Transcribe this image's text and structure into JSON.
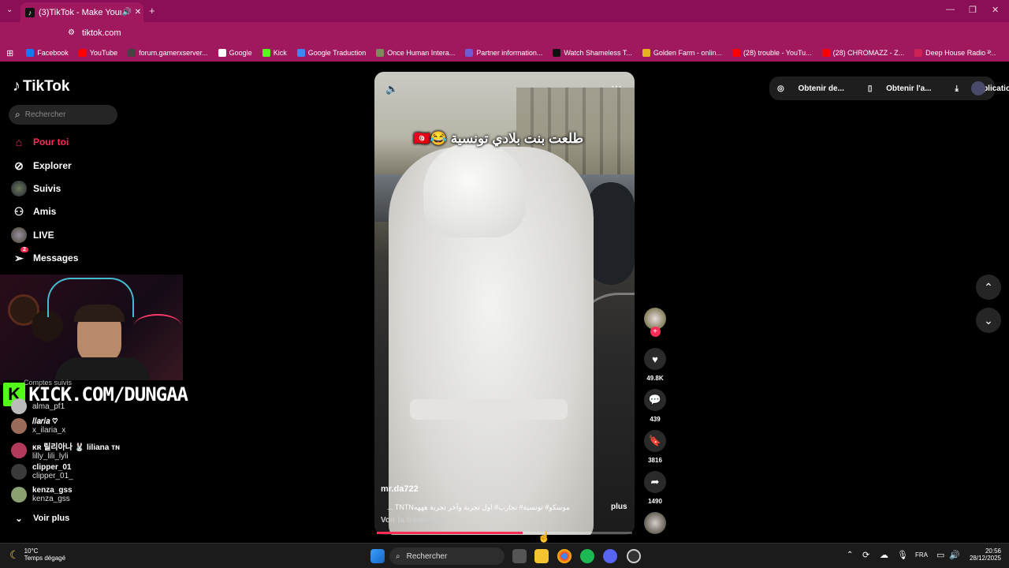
{
  "browser": {
    "tab_title": "(3)TikTok - Make Your Day",
    "url": "tiktok.com",
    "bookmarks": [
      {
        "label": "Facebook",
        "color": "#1877f2"
      },
      {
        "label": "YouTube",
        "color": "#ff0000"
      },
      {
        "label": "forum.gamerxserver...",
        "color": "#444444"
      },
      {
        "label": "Google",
        "color": "#ffffff"
      },
      {
        "label": "Kick",
        "color": "#53fc18"
      },
      {
        "label": "Google Traduction",
        "color": "#4285f4"
      },
      {
        "label": "Once Human Intera...",
        "color": "#7a8a5a"
      },
      {
        "label": "Partner information...",
        "color": "#6f5bd8"
      },
      {
        "label": "Watch Shameless T...",
        "color": "#111111"
      },
      {
        "label": "Golden Farm - onlin...",
        "color": "#e6b422"
      },
      {
        "label": "(28) trouble - YouTu...",
        "color": "#ff0000"
      },
      {
        "label": "(28) CHROMAZZ - Z...",
        "color": "#ff0000"
      },
      {
        "label": "Deep House Radio -...",
        "color": "#cc2255"
      }
    ]
  },
  "sidebar": {
    "logo": "TikTok",
    "search_placeholder": "Rechercher",
    "nav": [
      {
        "label": "Pour toi",
        "icon": "home-icon",
        "active": true
      },
      {
        "label": "Explorer",
        "icon": "compass-icon"
      },
      {
        "label": "Suivis",
        "icon": "avatar"
      },
      {
        "label": "Amis",
        "icon": "friends-icon"
      },
      {
        "label": "LIVE",
        "icon": "avatar"
      },
      {
        "label": "Messages",
        "icon": "paper-plane-icon",
        "badge": "2"
      }
    ],
    "following_header": "Comptes suivis",
    "accounts": [
      {
        "name": "",
        "handle": "alma_pf1",
        "color": "#bbbbbb"
      },
      {
        "name": "𝐼𝑙𝑎𝑟𝑖𝑎 ♡",
        "handle": "x_ilaria_x",
        "color": "#9a6a5a"
      },
      {
        "name": "ᴋʀ 릴리아나 🐰 liliana ᴛɴ",
        "handle": "lilly_lili_lyli",
        "color": "#b33a5a"
      },
      {
        "name": "clipper_01",
        "handle": "clipper_01_",
        "color": "#3a3a3a"
      },
      {
        "name": "kenza_gss",
        "handle": "kenza_gss",
        "color": "#8aa070"
      }
    ],
    "see_more": "Voir plus"
  },
  "overlay": {
    "kick_text": "KICK.COM/DUNGAA"
  },
  "video": {
    "title": "طلعت بنت بلادي تونسية 😂🇹🇳",
    "author": "mr.da722",
    "description": "موسكو# تونسية# تجارب# اول تجربة وآخر تجربة ههههTNTN ...",
    "more": "plus",
    "translate": "Voir la traduction",
    "progress": 0.57
  },
  "actions": {
    "likes": "49.8K",
    "comments": "439",
    "saves": "3816",
    "shares": "1490"
  },
  "topbar": {
    "coins": "Obtenir de...",
    "app": "Obtenir l'a...",
    "download": "Applicatio..."
  },
  "taskbar": {
    "temp": "10°C",
    "weather": "Temps dégagé",
    "search": "Rechercher",
    "lang": "FRA",
    "time": "20:56",
    "date": "28/12/2025"
  }
}
